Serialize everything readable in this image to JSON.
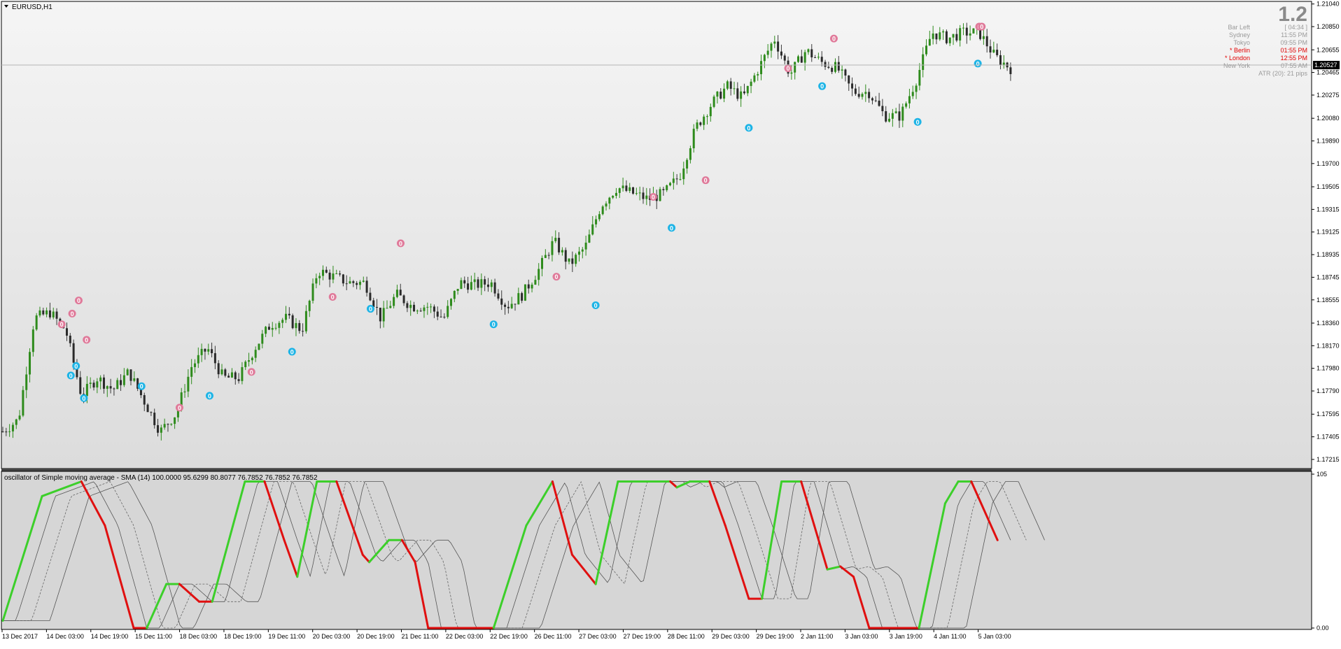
{
  "window": {
    "symbol_label": "EURUSD,H1"
  },
  "info_panel": {
    "big_value": "1.2",
    "rows": [
      {
        "label": "Bar Left",
        "value": "[ 04:34 ]",
        "color": "#9a9a9a"
      },
      {
        "label": "Sydney",
        "value": "11:55 PM",
        "color": "#9a9a9a"
      },
      {
        "label": "Tokyo",
        "value": "09:55 PM",
        "color": "#9a9a9a"
      },
      {
        "label": "* Berlin",
        "value": "01:55 PM",
        "color": "#e00000"
      },
      {
        "label": "* London",
        "value": "12:55 PM",
        "color": "#e00000"
      },
      {
        "label": "New York",
        "value": "07:55 AM",
        "color": "#9a9a9a"
      }
    ],
    "atr": "ATR (20): 21 pips"
  },
  "colors": {
    "candle_up": "#2e8b1c",
    "candle_down": "#3a3a3a",
    "marker_high": "#e07a9a",
    "marker_low": "#1eb4e6",
    "osc_up": "#3ccf2a",
    "osc_down": "#e01010",
    "price_line": "#c0c0c0",
    "current_price_bg": "#000000"
  },
  "chart_data": [
    {
      "type": "candlestick",
      "title": "EURUSD,H1",
      "ylim": [
        1.1715,
        1.2105
      ],
      "y_ticks": [
        "1.21040",
        "1.20850",
        "1.20655",
        "1.20465",
        "1.20275",
        "1.20080",
        "1.19890",
        "1.19700",
        "1.19505",
        "1.19315",
        "1.19125",
        "1.18935",
        "1.18745",
        "1.18555",
        "1.18360",
        "1.18170",
        "1.17980",
        "1.17790",
        "1.17595",
        "1.17405",
        "1.17215"
      ],
      "current_price": "1.20527",
      "x_ticks": [
        "13 Dec 2017",
        "14 Dec 03:00",
        "14 Dec 19:00",
        "15 Dec 11:00",
        "18 Dec 03:00",
        "18 Dec 19:00",
        "19 Dec 11:00",
        "20 Dec 03:00",
        "20 Dec 19:00",
        "21 Dec 11:00",
        "22 Dec 03:00",
        "22 Dec 19:00",
        "26 Dec 11:00",
        "27 Dec 03:00",
        "27 Dec 19:00",
        "28 Dec 11:00",
        "29 Dec 03:00",
        "29 Dec 19:00",
        "2 Jan 11:00",
        "3 Jan 03:00",
        "3 Jan 19:00",
        "4 Jan 11:00",
        "5 Jan 03:00"
      ],
      "close_path": [
        1.1745,
        1.1755,
        1.184,
        1.1845,
        1.183,
        1.1775,
        1.179,
        1.178,
        1.1795,
        1.177,
        1.1745,
        1.176,
        1.18,
        1.1815,
        1.179,
        1.179,
        1.1815,
        1.1835,
        1.184,
        1.183,
        1.188,
        1.1875,
        1.187,
        1.187,
        1.184,
        1.186,
        1.185,
        1.185,
        1.184,
        1.187,
        1.1868,
        1.187,
        1.185,
        1.186,
        1.188,
        1.1905,
        1.1885,
        1.19,
        1.1935,
        1.195,
        1.1945,
        1.194,
        1.1945,
        1.196,
        1.2,
        1.202,
        1.2035,
        1.2025,
        1.205,
        1.2075,
        1.2045,
        1.2065,
        1.2055,
        1.205,
        1.203,
        1.203,
        1.201,
        1.201,
        1.204,
        1.208,
        1.2075,
        1.208,
        1.208,
        1.206,
        1.205
      ],
      "markers": {
        "label": "0",
        "high": [
          [
            0.045,
            1.1835
          ],
          [
            0.053,
            1.1844
          ],
          [
            0.058,
            1.1855
          ],
          [
            0.064,
            1.1822
          ],
          [
            0.135,
            1.1765
          ],
          [
            0.19,
            1.1795
          ],
          [
            0.252,
            1.1858
          ],
          [
            0.304,
            1.1903
          ],
          [
            0.423,
            1.1875
          ],
          [
            0.497,
            1.1942
          ],
          [
            0.537,
            1.1956
          ],
          [
            0.6,
            1.205
          ],
          [
            0.635,
            1.2075
          ],
          [
            0.746,
            1.2085
          ],
          [
            0.748,
            1.2085
          ]
        ],
        "low": [
          [
            0.052,
            1.1792
          ],
          [
            0.056,
            1.18
          ],
          [
            0.062,
            1.1773
          ],
          [
            0.106,
            1.1783
          ],
          [
            0.158,
            1.1775
          ],
          [
            0.221,
            1.1812
          ],
          [
            0.281,
            1.1848
          ],
          [
            0.375,
            1.1835
          ],
          [
            0.453,
            1.1851
          ],
          [
            0.511,
            1.1916
          ],
          [
            0.57,
            1.2
          ],
          [
            0.626,
            1.2035
          ],
          [
            0.699,
            1.2005
          ],
          [
            0.745,
            1.2054
          ]
        ]
      }
    },
    {
      "type": "line",
      "title": "oscillator of Simple moving average - SMA (14) 100.0000 95.6299 80.8077 76.7852 76.7852 76.7852",
      "ylim": [
        0,
        105
      ],
      "y_ticks": [
        "105",
        "0.00"
      ],
      "main_line": [
        [
          0,
          5
        ],
        [
          0.03,
          90
        ],
        [
          0.06,
          100
        ],
        [
          0.078,
          70
        ],
        [
          0.1,
          0
        ],
        [
          0.11,
          0
        ],
        [
          0.125,
          30
        ],
        [
          0.135,
          30
        ],
        [
          0.15,
          18
        ],
        [
          0.16,
          18
        ],
        [
          0.185,
          100
        ],
        [
          0.2,
          100
        ],
        [
          0.215,
          60
        ],
        [
          0.225,
          35
        ],
        [
          0.24,
          100
        ],
        [
          0.255,
          100
        ],
        [
          0.275,
          50
        ],
        [
          0.28,
          45
        ],
        [
          0.295,
          60
        ],
        [
          0.305,
          60
        ],
        [
          0.315,
          45
        ],
        [
          0.325,
          0
        ],
        [
          0.375,
          0
        ],
        [
          0.4,
          70
        ],
        [
          0.42,
          100
        ],
        [
          0.435,
          50
        ],
        [
          0.453,
          30
        ],
        [
          0.47,
          100
        ],
        [
          0.51,
          100
        ],
        [
          0.515,
          96
        ],
        [
          0.525,
          100
        ],
        [
          0.54,
          100
        ],
        [
          0.552,
          70
        ],
        [
          0.57,
          20
        ],
        [
          0.58,
          20
        ],
        [
          0.595,
          100
        ],
        [
          0.61,
          100
        ],
        [
          0.62,
          70
        ],
        [
          0.63,
          40
        ],
        [
          0.64,
          42
        ],
        [
          0.65,
          35
        ],
        [
          0.662,
          0
        ],
        [
          0.7,
          0
        ],
        [
          0.72,
          85
        ],
        [
          0.73,
          100
        ],
        [
          0.74,
          100
        ],
        [
          0.76,
          60
        ]
      ],
      "band_offsets": [
        0.01,
        0.022,
        0.036
      ]
    }
  ]
}
